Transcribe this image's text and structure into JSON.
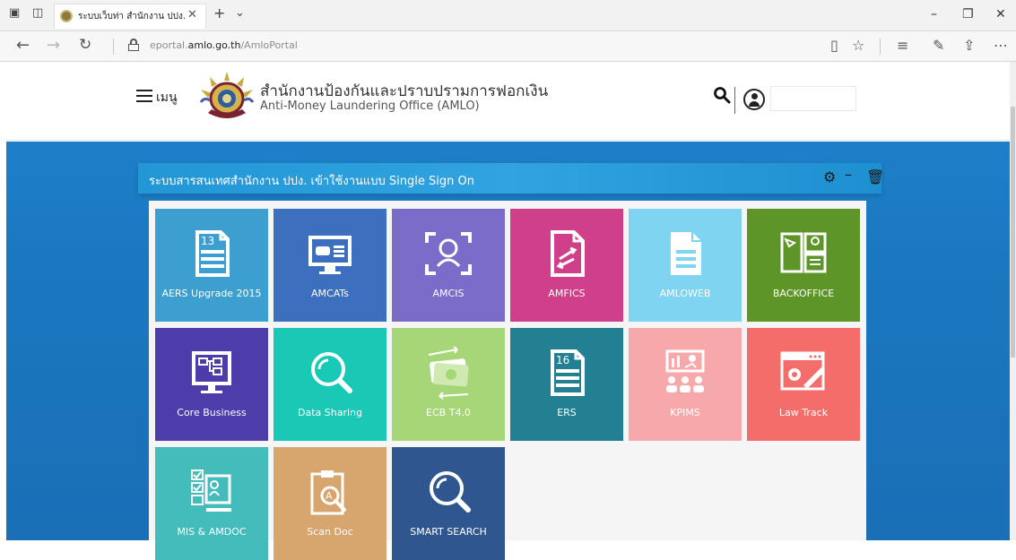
{
  "browser": {
    "tab_title": "ระบบเว็บท่า สำนักงาน ปปง.",
    "url_prefix": "eportal.",
    "url_domain": "amlo.go.th",
    "url_path": "/AmloPortal"
  },
  "header": {
    "menu_label": "เมนู",
    "title_th": "สำนักงานป้องกันและปราบปรามการฟอกเงิน",
    "title_en": "Anti-Money Laundering Office (AMLO)"
  },
  "panel": {
    "title": "ระบบสารสนเทศสำนักงาน ปปง. เข้าใช้งานแบบ Single Sign On"
  },
  "apps": [
    {
      "label": "AERS Upgrade 2015",
      "icon": "calendar-13-icon",
      "color": "#3d9fcf"
    },
    {
      "label": "AMCATs",
      "icon": "monitor-car-icon",
      "color": "#3c6fbd"
    },
    {
      "label": "AMCIS",
      "icon": "face-scan-icon",
      "color": "#7b6cc9"
    },
    {
      "label": "AMFICS",
      "icon": "document-exchange-icon",
      "color": "#cf3f8a"
    },
    {
      "label": "AMLOWEB",
      "icon": "document-lines-icon",
      "color": "#7ed4f1"
    },
    {
      "label": "BACKOFFICE",
      "icon": "dashboard-panels-icon",
      "color": "#5d9528"
    },
    {
      "label": "Core Business",
      "icon": "monitor-hierarchy-icon",
      "color": "#4d3dab"
    },
    {
      "label": "Data Sharing",
      "icon": "magnifier-icon",
      "color": "#19c9b6"
    },
    {
      "label": "ECB T4.0",
      "icon": "money-bills-icon",
      "color": "#a7d678"
    },
    {
      "label": "ERS",
      "icon": "calendar-16-icon",
      "color": "#237f92"
    },
    {
      "label": "KPIMS",
      "icon": "presentation-icon",
      "color": "#f7a8aa"
    },
    {
      "label": "Law Track",
      "icon": "browser-tools-icon",
      "color": "#f36d6b"
    },
    {
      "label": "MIS & AMDOC",
      "icon": "checklist-contact-icon",
      "color": "#44bcbc"
    },
    {
      "label": "Scan Doc",
      "icon": "clipboard-scan-icon",
      "color": "#d7a66e"
    },
    {
      "label": "SMART SEARCH",
      "icon": "magnifier-icon",
      "color": "#2f568f"
    }
  ]
}
